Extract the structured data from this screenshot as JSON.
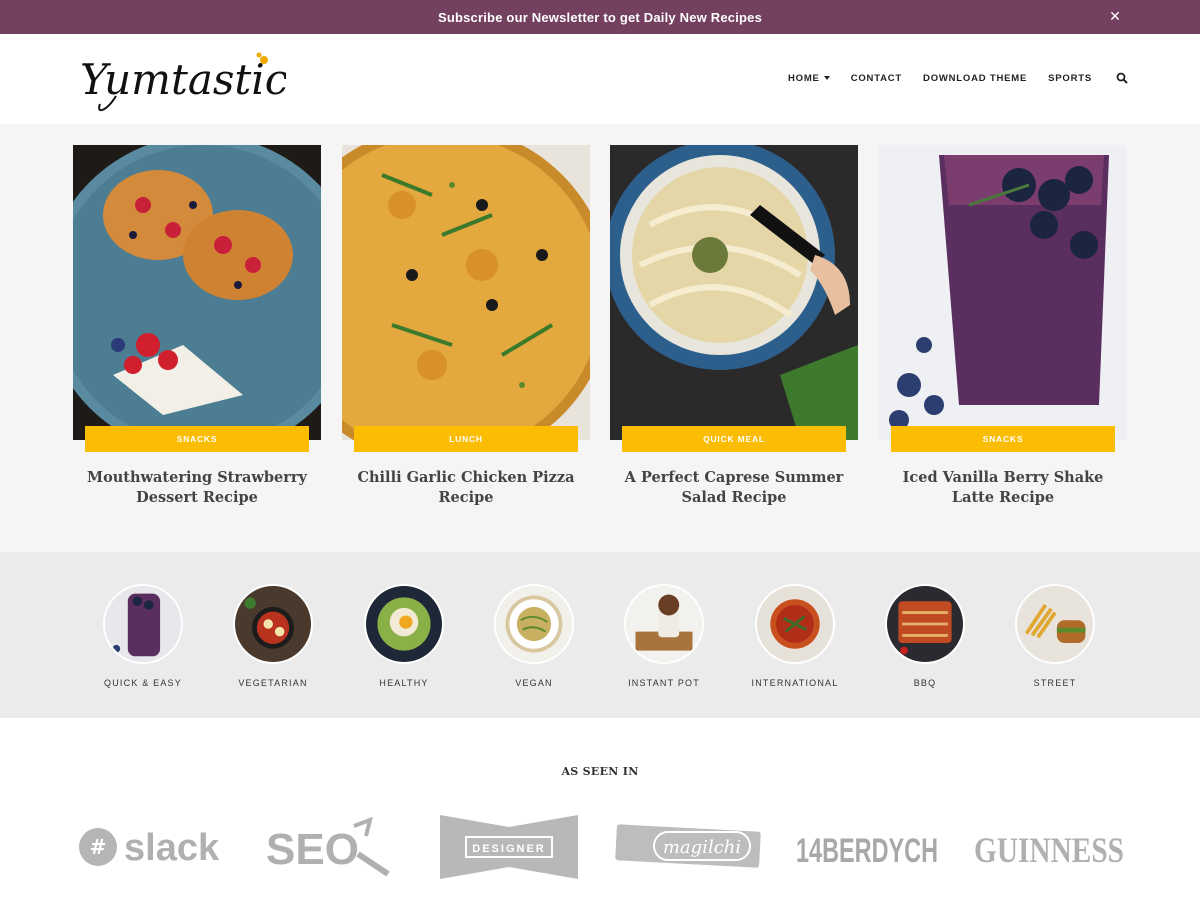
{
  "topbar": {
    "message": "Subscribe our Newsletter to get Daily New Recipes",
    "close_glyph": "✕"
  },
  "header": {
    "logo_text": "Yumtastic",
    "nav": [
      {
        "label": "HOME",
        "has_dropdown": true
      },
      {
        "label": "CONTACT",
        "has_dropdown": false
      },
      {
        "label": "DOWNLOAD THEME",
        "has_dropdown": false
      },
      {
        "label": "SPORTS",
        "has_dropdown": false
      }
    ],
    "search_icon": "search-icon"
  },
  "featured": [
    {
      "tag": "SNACKS",
      "title": "Mouthwatering Strawberry Dessert Recipe",
      "image": "pancake-strawberries-photo"
    },
    {
      "tag": "LUNCH",
      "title": "Chilli Garlic Chicken Pizza Recipe",
      "image": "pizza-photo"
    },
    {
      "tag": "QUICK MEAL",
      "title": "A Perfect Caprese Summer Salad Recipe",
      "image": "noodles-bowl-photo"
    },
    {
      "tag": "SNACKS",
      "title": "Iced Vanilla Berry Shake Latte Recipe",
      "image": "berry-shake-photo"
    }
  ],
  "categories": [
    {
      "label": "QUICK & EASY"
    },
    {
      "label": "VEGETARIAN"
    },
    {
      "label": "HEALTHY"
    },
    {
      "label": "VEGAN"
    },
    {
      "label": "INSTANT POT"
    },
    {
      "label": "INTERNATIONAL"
    },
    {
      "label": "BBQ"
    },
    {
      "label": "STREET"
    }
  ],
  "as_seen_in": {
    "heading": "AS SEEN IN",
    "brands": [
      "slack",
      "SEO",
      "DESIGNER",
      "magilchi",
      "14BERDYCH",
      "GUINNESS"
    ]
  },
  "colors": {
    "topbar": "#73405f",
    "tag": "#fbbc04",
    "featured_bg": "#f5f5f5",
    "cats_bg": "#ebebeb",
    "logo_accent": "#f2a900"
  }
}
